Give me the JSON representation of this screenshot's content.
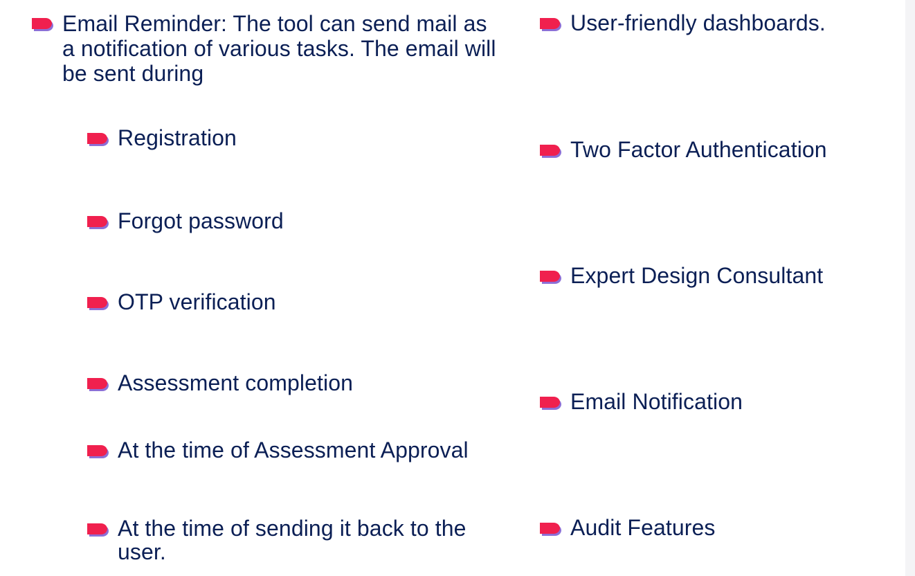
{
  "left_column": {
    "email_reminder": "Email Reminder: The tool can send mail as a notification of various tasks. The email will be sent during",
    "sub_items": [
      "Registration",
      "Forgot password",
      "OTP verification",
      "Assessment completion",
      "At the time of Assessment Approval",
      "At the time of sending it back to the user."
    ]
  },
  "right_column": {
    "items": [
      "User-friendly dashboards.",
      "Two Factor Authentication",
      "Expert Design Consultant",
      "Email Notification",
      "Audit Features"
    ]
  },
  "icons": {
    "bullet": "tab-bullet-icon"
  },
  "colors": {
    "bullet_fill": "#f0204e",
    "bullet_shadow": "#8c6fd6",
    "text": "#0b1f55"
  }
}
